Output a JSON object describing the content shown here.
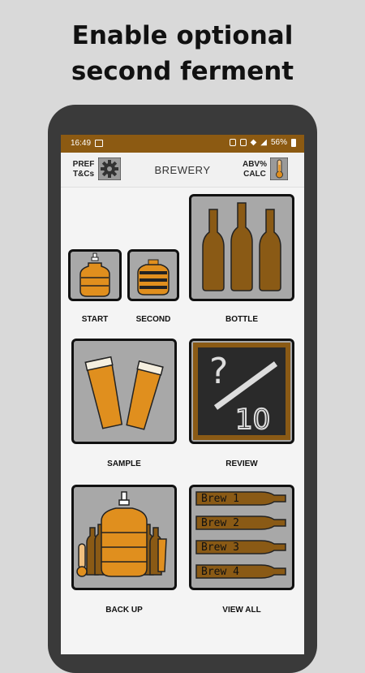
{
  "promo": {
    "line1": "Enable optional",
    "line2": "second ferment"
  },
  "status_bar": {
    "time": "16:49",
    "battery": "56%"
  },
  "app_bar": {
    "pref_line1": "PREF",
    "pref_line2": "T&Cs",
    "title": "BREWERY",
    "abv_line1": "ABV%",
    "abv_line2": "CALC"
  },
  "tiles": {
    "start": "START",
    "second": "SECOND",
    "bottle": "BOTTLE",
    "sample": "SAMPLE",
    "review": "REVIEW",
    "review_art_top": "?",
    "review_art_bottom": "10",
    "backup": "BACK UP",
    "view_all": "VIEW ALL",
    "brews": [
      "Brew 1",
      "Brew 2",
      "Brew 3",
      "Brew 4"
    ]
  },
  "colors": {
    "brand_brown": "#8c5a12",
    "amber": "#e08f1e",
    "bottle_brown": "#8a5a15",
    "tile_gray": "#a8a8a8"
  }
}
